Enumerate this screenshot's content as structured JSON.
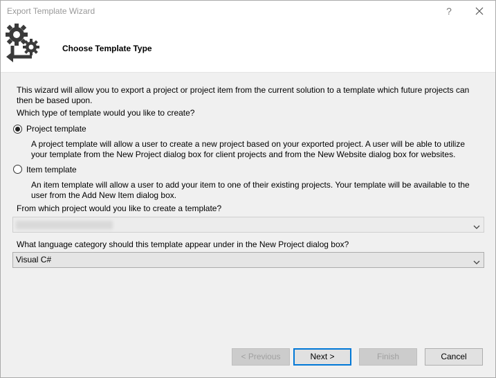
{
  "window": {
    "title": "Export Template Wizard",
    "help_glyph": "?",
    "icons": [
      "help-icon",
      "close-icon",
      "gears-icon"
    ]
  },
  "header": {
    "title": "Choose Template Type"
  },
  "content": {
    "intro": "This wizard will allow you to export a project or project item from the current solution to a template which future projects can then be based upon.",
    "question_type": "Which type of template would you like to create?",
    "options": [
      {
        "label": "Project template",
        "selected": true,
        "description": "A project template will allow a user to create a new project based on your exported project. A user will be able to utilize your template from the New Project dialog box for client projects and from the New Website dialog box for websites."
      },
      {
        "label": "Item template",
        "selected": false,
        "description": "An item template will allow a user to add your item to one of their existing projects. Your template will be available to the user from the Add New Item dialog box."
      }
    ],
    "question_project": "From which project would you like to create a template?",
    "project_select": {
      "value": "",
      "disabled": true
    },
    "question_language": "What language category should this template appear under in the New Project dialog box?",
    "language_select": {
      "value": "Visual C#"
    }
  },
  "buttons": {
    "previous": "< Previous",
    "next": "Next >",
    "finish": "Finish",
    "cancel": "Cancel"
  },
  "colors": {
    "default_button_border": "#0078d7",
    "header_bg": "#ffffff",
    "body_bg": "#f0f0f0"
  }
}
